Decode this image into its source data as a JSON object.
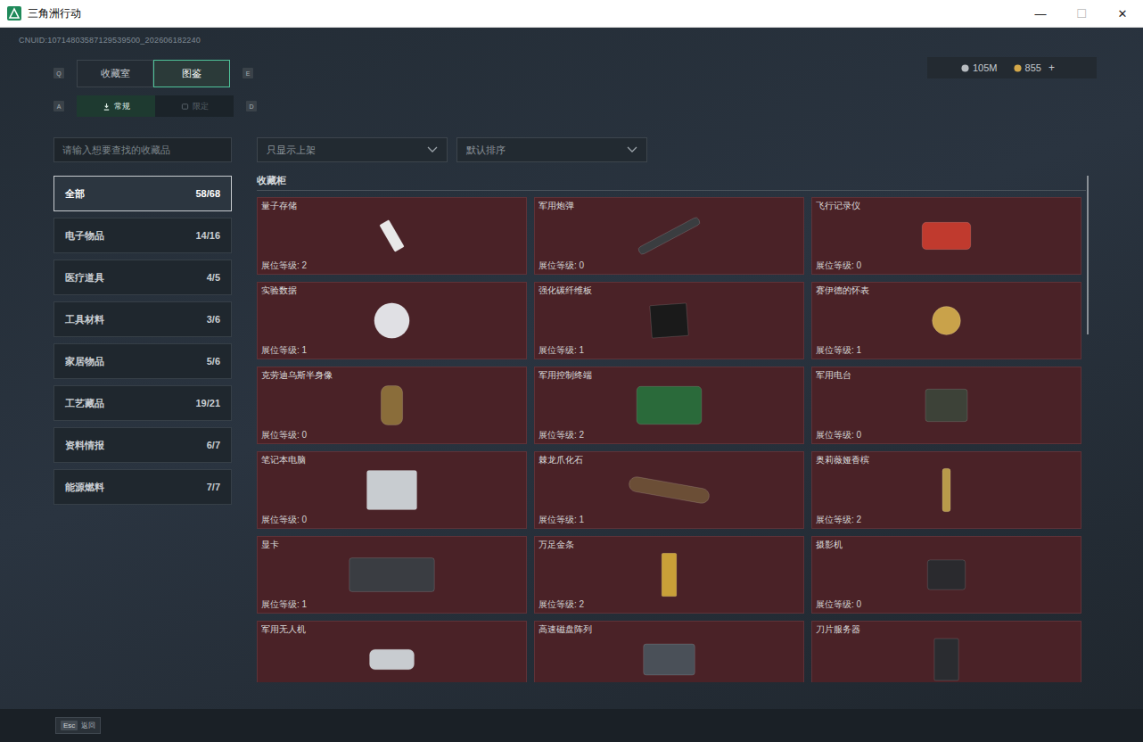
{
  "window": {
    "title": "三角洲行动",
    "controls": [
      {
        "glyph": "—",
        "disabled": false
      },
      {
        "glyph": "☐",
        "disabled": true
      },
      {
        "glyph": "✕",
        "disabled": false
      }
    ]
  },
  "uid": "CNUID:10714803587129539500_202606182240",
  "currencies": [
    {
      "value": "105M",
      "color": "#b8bcc0"
    },
    {
      "value": "855",
      "color": "#d4a84a"
    }
  ],
  "add_button": "+",
  "tabs": {
    "prev_key": "Q",
    "next_key": "E",
    "items": [
      {
        "label": "收藏室",
        "selected": false
      },
      {
        "label": "图鉴",
        "selected": true
      }
    ]
  },
  "subtabs": {
    "prev_key": "A",
    "next_key": "D",
    "items": [
      {
        "label": "常规",
        "selected": true
      },
      {
        "label": "限定",
        "selected": false
      }
    ]
  },
  "search": {
    "placeholder": "请输入想要查找的收藏品"
  },
  "categories": [
    {
      "label": "全部",
      "count": "58/68",
      "selected": true
    },
    {
      "label": "电子物品",
      "count": "14/16",
      "selected": false
    },
    {
      "label": "医疗道具",
      "count": "4/5",
      "selected": false
    },
    {
      "label": "工具材料",
      "count": "3/6",
      "selected": false
    },
    {
      "label": "家居物品",
      "count": "5/6",
      "selected": false
    },
    {
      "label": "工艺藏品",
      "count": "19/21",
      "selected": false
    },
    {
      "label": "资料情报",
      "count": "6/7",
      "selected": false
    },
    {
      "label": "能源燃料",
      "count": "7/7",
      "selected": false
    }
  ],
  "filters": [
    {
      "label": "只显示上架"
    },
    {
      "label": "默认排序"
    }
  ],
  "section": "收藏柜",
  "items": [
    {
      "name": "量子存储",
      "level": "展位等级: 2"
    },
    {
      "name": "军用炮弹",
      "level": "展位等级: 0"
    },
    {
      "name": "飞行记录仪",
      "level": "展位等级: 0"
    },
    {
      "name": "实验数据",
      "level": "展位等级: 1"
    },
    {
      "name": "强化碳纤维板",
      "level": "展位等级: 1"
    },
    {
      "name": "赛伊德的怀表",
      "level": "展位等级: 1"
    },
    {
      "name": "克劳迪乌斯半身像",
      "level": "展位等级: 0"
    },
    {
      "name": "军用控制终端",
      "level": "展位等级: 2"
    },
    {
      "name": "军用电台",
      "level": "展位等级: 0"
    },
    {
      "name": "笔记本电脑",
      "level": "展位等级: 0"
    },
    {
      "name": "棘龙爪化石",
      "level": "展位等级: 1"
    },
    {
      "name": "奥莉薇娅香槟",
      "level": "展位等级: 2"
    },
    {
      "name": "显卡",
      "level": "展位等级: 1"
    },
    {
      "name": "万足金条",
      "level": "展位等级: 2"
    },
    {
      "name": "摄影机",
      "level": "展位等级: 0"
    },
    {
      "name": "军用无人机",
      "level": ""
    },
    {
      "name": "高速磁盘阵列",
      "level": ""
    },
    {
      "name": "刀片服务器",
      "level": ""
    }
  ],
  "footer": {
    "key": "Esc",
    "label": "返回"
  }
}
